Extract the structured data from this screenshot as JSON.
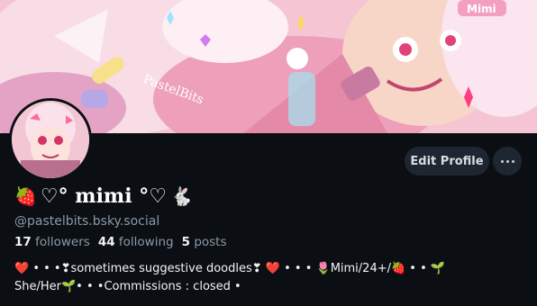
{
  "profile": {
    "display_name": "♡° mimi °♡",
    "handle": "@pastelbits.bsky.social",
    "name_prefix_icon": "strawberry-icon",
    "name_suffix_icon": "rabbit-icon",
    "banner_signature": "PastelBits",
    "banner_tag": "Mimi"
  },
  "actions": {
    "edit_label": "Edit Profile",
    "more_icon": "ellipsis-icon"
  },
  "stats": {
    "followers_count": "17",
    "followers_label": "followers",
    "following_count": "44",
    "following_label": "following",
    "posts_count": "5",
    "posts_label": "posts"
  },
  "bio": {
    "line1": "❤️ • • •❣sometimes suggestive doodles❣ ❤️ • • • 🌷Mimi/24+/🍓 • • 🌱",
    "line2": "She/Her🌱• • •Commissions : closed •"
  },
  "colors": {
    "background": "#0b0f14",
    "button_bg": "#1e2731",
    "muted_text": "#8b98a5",
    "banner_pink": "#f3b6c9"
  }
}
